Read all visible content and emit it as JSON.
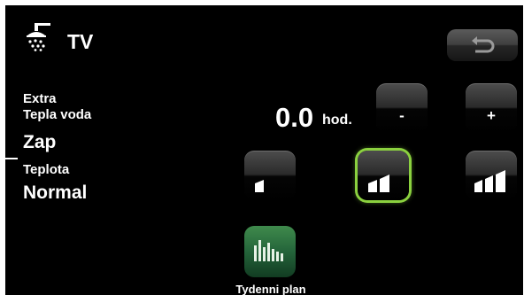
{
  "header": {
    "title": "TV",
    "icon": "shower-icon",
    "back_icon": "back-arrow-icon"
  },
  "extra_hot_water": {
    "label_line1": "Extra",
    "label_line2": "Tepla voda",
    "status": "Zap",
    "hours_value": "0.0",
    "hours_unit": "hod.",
    "decrease_label": "-",
    "increase_label": "+"
  },
  "temperature": {
    "label": "Teplota",
    "value": "Normal",
    "levels": [
      {
        "name": "low",
        "icon": "level-low-icon",
        "selected": false
      },
      {
        "name": "normal",
        "icon": "level-normal-icon",
        "selected": true
      },
      {
        "name": "high",
        "icon": "level-high-icon",
        "selected": false
      }
    ],
    "selected_color": "#8bd13f"
  },
  "weekly_plan": {
    "label": "Tydenni plan",
    "icon": "weekly-schedule-icon",
    "color": "#2e7a43"
  }
}
